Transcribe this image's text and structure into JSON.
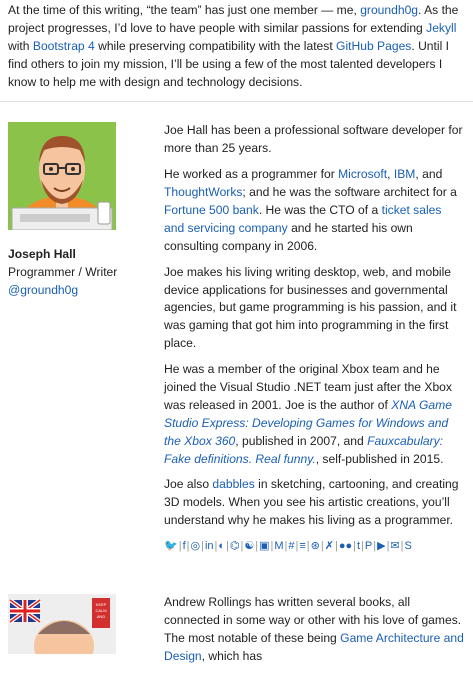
{
  "intro": {
    "t1": "At the time of this writing, “the team” has just one member — me, ",
    "handle": "groundh0g",
    "t2": ". As the project progresses, I’d love to have people with similar passions for extending ",
    "jekyll": "Jekyll",
    "t3": " with ",
    "bootstrap": "Bootstrap 4",
    "t4": " while preserving compatibility with the latest ",
    "ghpages": "GitHub Pages",
    "t5": ". Until I find others to join my mission, I’ll be using a few of the most talented developers I know to help me with design and technology decisions."
  },
  "member1": {
    "name": "Joseph Hall",
    "role": "Programmer / Writer",
    "handle": "@groundh0g",
    "p1": "Joe Hall has been a professional software developer for more than 25 years.",
    "p2": {
      "a": "He worked as a programmer for ",
      "microsoft": "Microsoft",
      "b": ", ",
      "ibm": "IBM",
      "c": ", and ",
      "thoughtworks": "ThoughtWorks",
      "d": "; and he was the software architect for a ",
      "fortune": "Fortune 500 bank",
      "e": ". He was the CTO of a ",
      "ticket": "ticket sales and servicing company",
      "f": " and he started his own consulting company in 2006."
    },
    "p3": "Joe makes his living writing desktop, web, and mobile device applications for businesses and governmental agencies, but game programming is his passion, and it was gaming that got him into programming in the first place.",
    "p4": {
      "a": "He was a member of the original Xbox team and he joined the Visual Studio .NET team just after the Xbox was released in 2001. Joe is the author of ",
      "book": "XNA Game Studio Express: Developing Games for Windows and the Xbox 360",
      "b": ", published in 2007, and ",
      "faux": "Fauxcabulary: Fake definitions. Real funny.",
      "c": ", self-published in 2015."
    },
    "p5": {
      "a": "Joe also ",
      "dabbles": "dabbles",
      "b": " in sketching, cartooning, and creating 3D models. When you see his artistic creations, you’ll understand why he makes his living as a programmer."
    },
    "social_icons": [
      "twitter-icon",
      "facebook-icon",
      "instagram-icon",
      "linkedin-icon",
      "github-icon",
      "codepen-icon",
      "github-alt-icon",
      "pocket-icon",
      "medium-icon",
      "slack-icon",
      "stack-overflow-icon",
      "dribbble-icon",
      "deviantart-icon",
      "flickr-icon",
      "tumblr-icon",
      "pinterest-icon",
      "youtube-icon",
      "twitch-icon",
      "skype-icon"
    ],
    "social_glyphs": [
      "🐦",
      "f",
      "◎",
      "in",
      "◐",
      "⌬",
      "☯",
      "▣",
      "M",
      "#",
      "≡",
      "⊛",
      "✗",
      "●●",
      "t",
      "P",
      "▶",
      "✉",
      "S"
    ]
  },
  "member2": {
    "p1": {
      "a": "Andrew Rollings has written several books, all connected in some way or other with his love of games. The most notable of these being ",
      "book": "Game Architecture and Design",
      "b": ", which has"
    },
    "mug_text": "KEEP CALM AND"
  }
}
